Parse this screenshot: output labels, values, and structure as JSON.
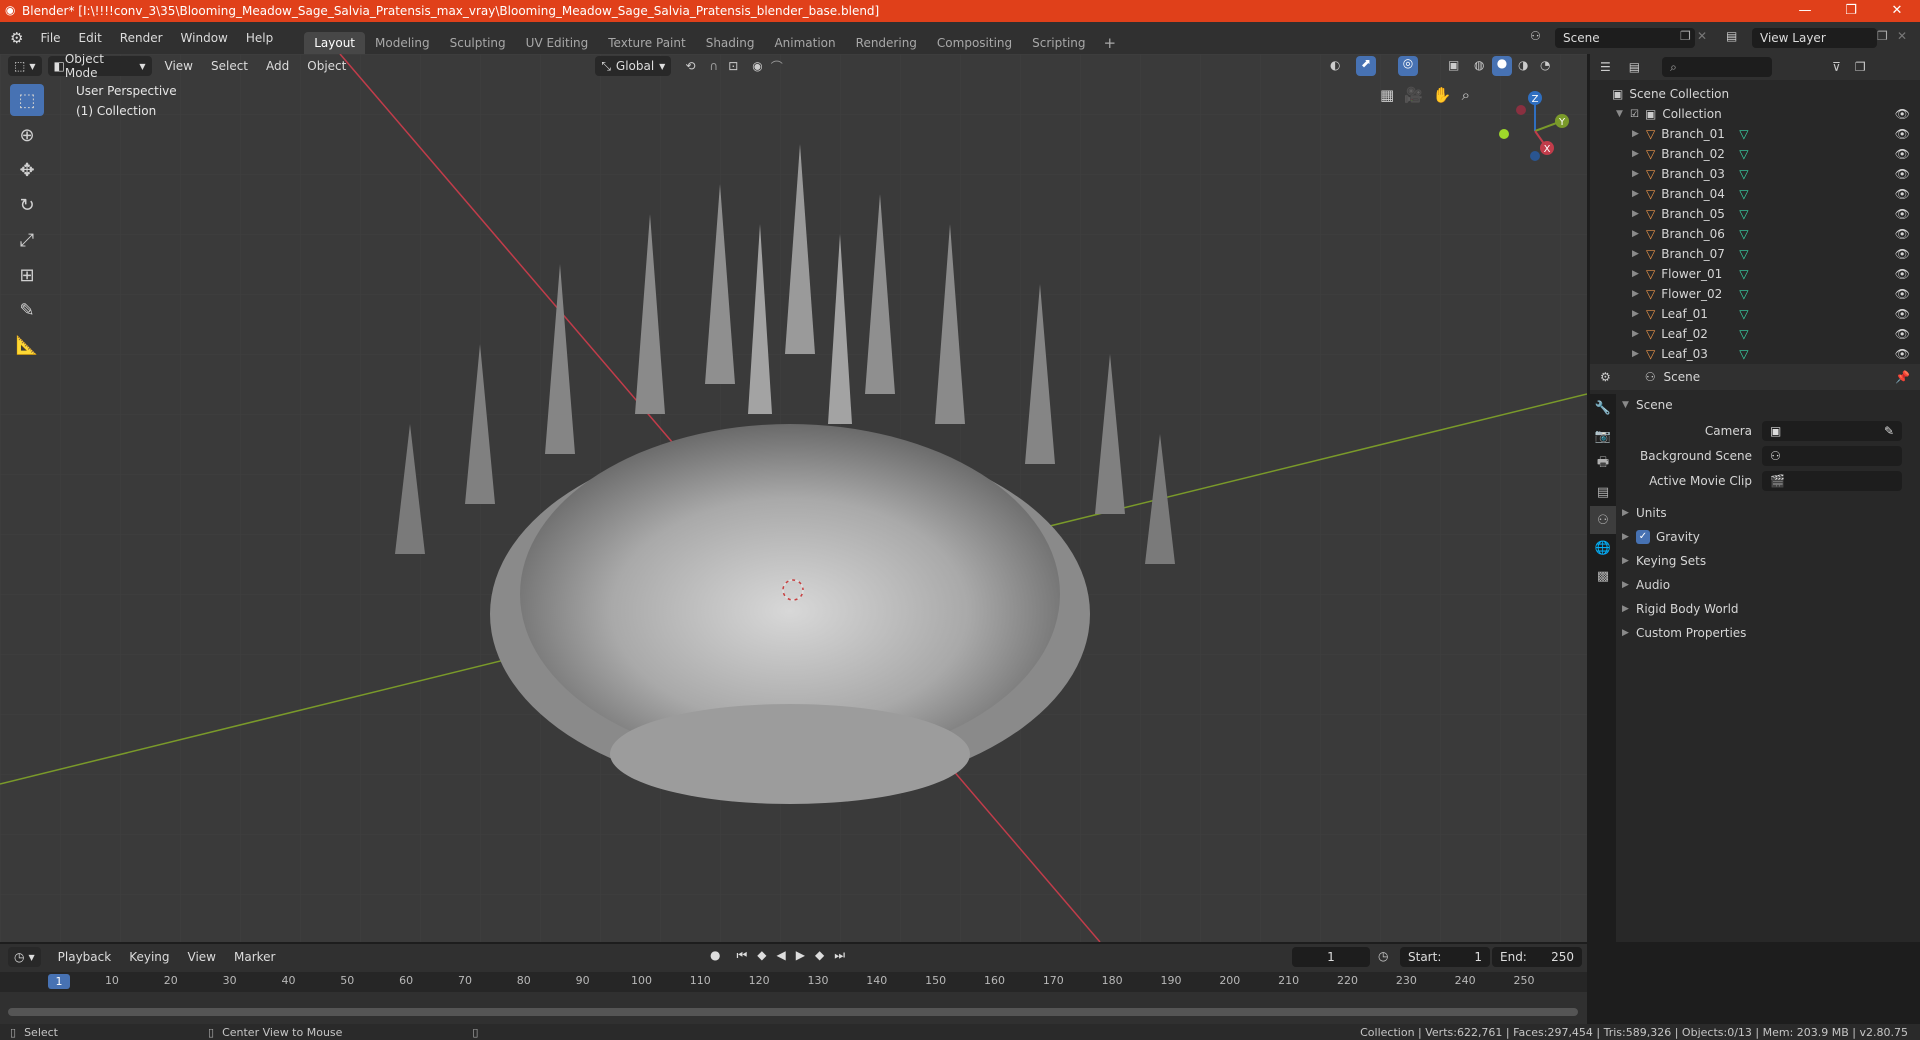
{
  "window": {
    "title": "Blender* [I:\\!!!!conv_3\\35\\Blooming_Meadow_Sage_Salvia_Pratensis_max_vray\\Blooming_Meadow_Sage_Salvia_Pratensis_blender_base.blend]",
    "minimize": "—",
    "maximize": "❐",
    "close": "✕"
  },
  "menus": [
    "File",
    "Edit",
    "Render",
    "Window",
    "Help"
  ],
  "workspaces": [
    "Layout",
    "Modeling",
    "Sculpting",
    "UV Editing",
    "Texture Paint",
    "Shading",
    "Animation",
    "Rendering",
    "Compositing",
    "Scripting"
  ],
  "active_workspace": "Layout",
  "scene_field": "Scene",
  "view_layer_field": "View Layer",
  "viewport": {
    "mode": "Object Mode",
    "menus": [
      "View",
      "Select",
      "Add",
      "Object"
    ],
    "orientation": "Global",
    "perspective_label": "User Perspective",
    "collection_label": "(1) Collection"
  },
  "gizmo": {
    "z": "Z",
    "y": "Y",
    "x": "X"
  },
  "outliner": {
    "root": "Scene Collection",
    "collection": "Collection",
    "objects": [
      "Branch_01",
      "Branch_02",
      "Branch_03",
      "Branch_04",
      "Branch_05",
      "Branch_06",
      "Branch_07",
      "Flower_01",
      "Flower_02",
      "Leaf_01",
      "Leaf_02",
      "Leaf_03"
    ]
  },
  "properties": {
    "header": "Scene",
    "panel_title": "Scene",
    "camera_label": "Camera",
    "background_label": "Background Scene",
    "movie_clip_label": "Active Movie Clip",
    "subpanels": [
      "Units",
      "Gravity",
      "Keying Sets",
      "Audio",
      "Rigid Body World",
      "Custom Properties"
    ]
  },
  "timeline": {
    "menus": [
      "Playback",
      "Keying",
      "View",
      "Marker"
    ],
    "current_frame": "1",
    "start_label": "Start:",
    "start": "1",
    "end_label": "End:",
    "end": "250",
    "ruler": [
      "1",
      "10",
      "20",
      "30",
      "40",
      "50",
      "60",
      "70",
      "80",
      "90",
      "100",
      "110",
      "120",
      "130",
      "140",
      "150",
      "160",
      "170",
      "180",
      "190",
      "200",
      "210",
      "220",
      "230",
      "240",
      "250"
    ]
  },
  "status": {
    "select": "Select",
    "center_view": "Center View to Mouse",
    "stats": "Collection | Verts:622,761 | Faces:297,454 | Tris:589,326 | Objects:0/13 | Mem: 203.9 MB | v2.80.75"
  },
  "colors": {
    "titlebar": "#e0401a",
    "accent": "#4772b3",
    "object_icon": "#e8944a",
    "mesh_icon": "#3ad6a8",
    "x_axis": "#c13c4a",
    "y_axis": "#7a9a2a"
  }
}
